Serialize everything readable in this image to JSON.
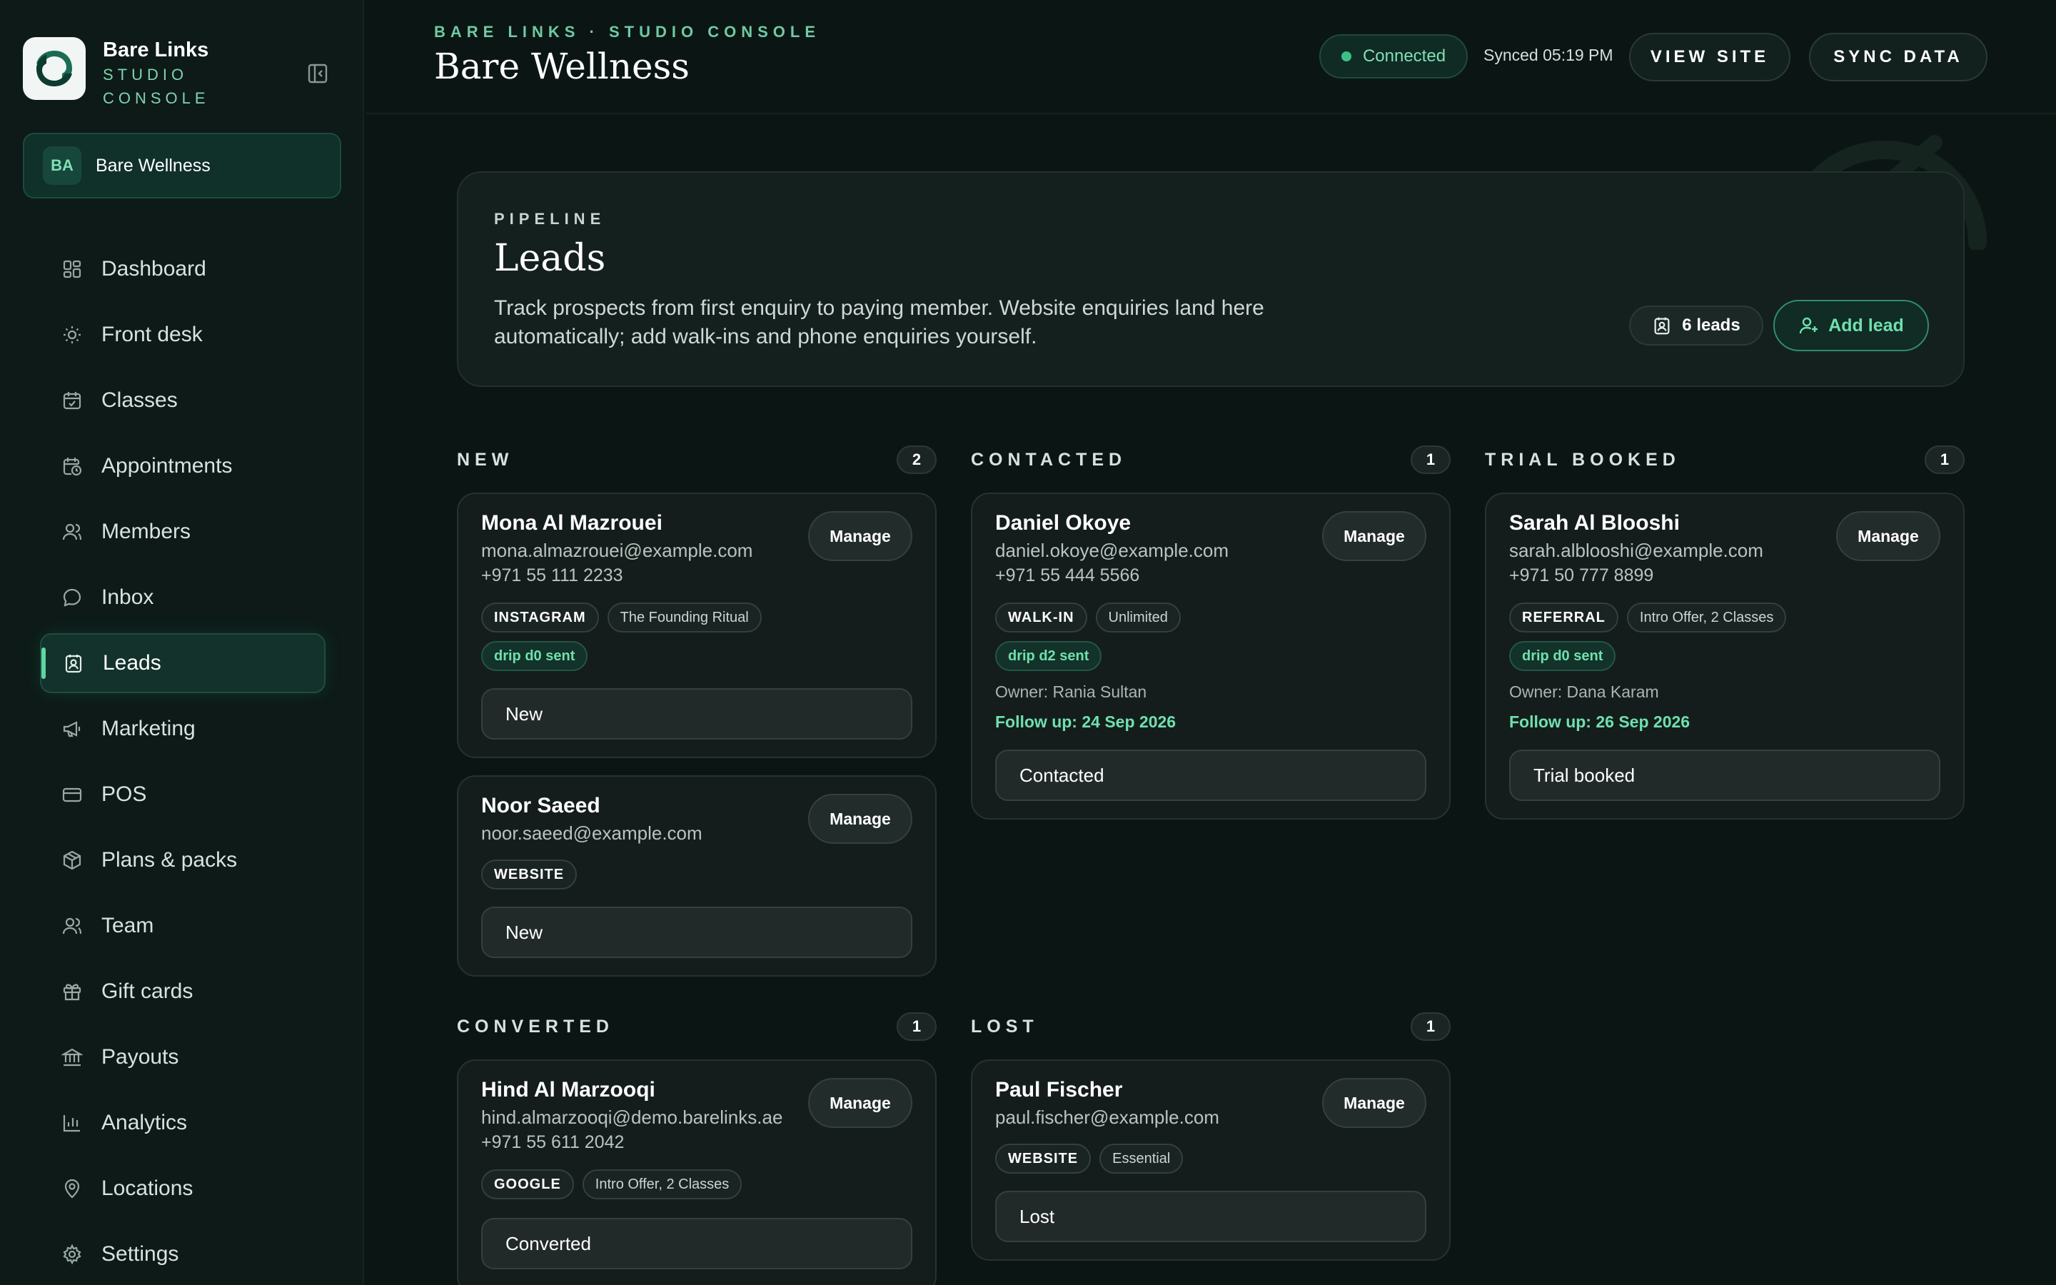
{
  "brand": {
    "name": "Bare Links",
    "sub1": "STUDIO",
    "sub2": "CONSOLE"
  },
  "workspace": {
    "initials": "BA",
    "name": "Bare Wellness"
  },
  "nav": [
    {
      "label": "Dashboard",
      "icon": "dashboard-icon"
    },
    {
      "label": "Front desk",
      "icon": "sun-icon"
    },
    {
      "label": "Classes",
      "icon": "calendar-icon"
    },
    {
      "label": "Appointments",
      "icon": "calendar-clock-icon"
    },
    {
      "label": "Members",
      "icon": "user-icon"
    },
    {
      "label": "Inbox",
      "icon": "chat-icon"
    },
    {
      "label": "Leads",
      "icon": "contact-icon",
      "active": true
    },
    {
      "label": "Marketing",
      "icon": "megaphone-icon"
    },
    {
      "label": "POS",
      "icon": "card-icon"
    },
    {
      "label": "Plans & packs",
      "icon": "box-icon"
    },
    {
      "label": "Team",
      "icon": "team-icon"
    },
    {
      "label": "Gift cards",
      "icon": "gift-icon"
    },
    {
      "label": "Payouts",
      "icon": "bank-icon"
    },
    {
      "label": "Analytics",
      "icon": "chart-icon"
    },
    {
      "label": "Locations",
      "icon": "pin-icon"
    },
    {
      "label": "Settings",
      "icon": "gear-icon"
    }
  ],
  "topbar": {
    "eyebrow": "BARE LINKS · STUDIO CONSOLE",
    "title": "Bare Wellness",
    "status": "Connected",
    "synced": "Synced 05:19 PM",
    "view_site": "VIEW SITE",
    "sync_data": "SYNC DATA"
  },
  "hero": {
    "eyebrow": "PIPELINE",
    "title": "Leads",
    "description": "Track prospects from first enquiry to paying member. Website enquiries land here automatically; add walk-ins and phone enquiries yourself.",
    "count": "6 leads",
    "add": "Add lead"
  },
  "manage_label": "Manage",
  "columns": {
    "new": {
      "label": "NEW",
      "count": "2"
    },
    "contacted": {
      "label": "CONTACTED",
      "count": "1"
    },
    "trial": {
      "label": "TRIAL BOOKED",
      "count": "1"
    },
    "converted": {
      "label": "CONVERTED",
      "count": "1"
    },
    "lost": {
      "label": "LOST",
      "count": "1"
    }
  },
  "leads": {
    "mona": {
      "name": "Mona Al Mazrouei",
      "email": "mona.almazrouei@example.com",
      "phone": "+971 55 111 2233",
      "source": "INSTAGRAM",
      "plan": "The Founding Ritual",
      "drip": "drip d0 sent",
      "status": "New"
    },
    "noor": {
      "name": "Noor Saeed",
      "email": "noor.saeed@example.com",
      "source": "WEBSITE",
      "status": "New"
    },
    "daniel": {
      "name": "Daniel Okoye",
      "email": "daniel.okoye@example.com",
      "phone": "+971 55 444 5566",
      "source": "WALK-IN",
      "plan": "Unlimited",
      "drip": "drip d2 sent",
      "owner": "Owner: Rania Sultan",
      "follow": "Follow up: 24 Sep 2026",
      "status": "Contacted"
    },
    "sarah": {
      "name": "Sarah Al Blooshi",
      "email": "sarah.alblooshi@example.com",
      "phone": "+971 50 777 8899",
      "source": "REFERRAL",
      "plan": "Intro Offer, 2 Classes",
      "drip": "drip d0 sent",
      "owner": "Owner: Dana Karam",
      "follow": "Follow up: 26 Sep 2026",
      "status": "Trial booked"
    },
    "hind": {
      "name": "Hind Al Marzooqi",
      "email": "hind.almarzooqi@demo.barelinks.ae",
      "phone": "+971 55 611 2042",
      "source": "GOOGLE",
      "plan": "Intro Offer, 2 Classes",
      "status": "Converted"
    },
    "paul": {
      "name": "Paul Fischer",
      "email": "paul.fischer@example.com",
      "source": "WEBSITE",
      "plan": "Essential",
      "status": "Lost"
    }
  },
  "colors": {
    "accent": "#6fe0ae",
    "background": "#0b1614",
    "card": "#141d1c"
  }
}
